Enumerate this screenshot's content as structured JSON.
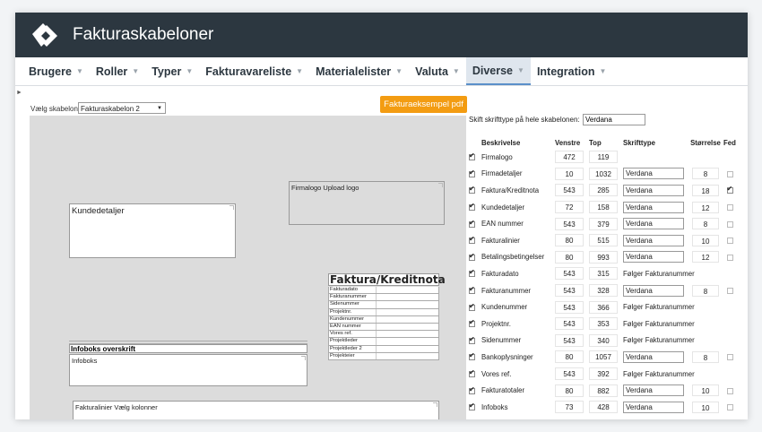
{
  "app": {
    "title": "Fakturaskabeloner"
  },
  "nav": [
    {
      "label": "Brugere"
    },
    {
      "label": "Roller"
    },
    {
      "label": "Typer"
    },
    {
      "label": "Fakturavareliste"
    },
    {
      "label": "Materialelister"
    },
    {
      "label": "Valuta"
    },
    {
      "label": "Diverse",
      "active": true
    },
    {
      "label": "Integration"
    }
  ],
  "editor": {
    "select_label": "Vælg skabelon",
    "template_value": "Fakturaskabelon 2",
    "pdf_button": "Fakturaeksempel pdf",
    "font_label": "Skift skrifttype på hele skabelonen:",
    "font_value": "Verdana"
  },
  "canvas": {
    "firmalogo": "Firmalogo Upload logo",
    "kundedetaljer": "Kundedetaljer",
    "faktura_title": "Faktura/Kreditnota",
    "faktura_fields": [
      "Fakturadato",
      "Fakturanummer",
      "Sidenummer",
      "Projektnr.",
      "Kundenummer",
      "EAN nummer",
      "Vores ref.",
      "Projektleder",
      "Projektleder 2",
      "Projekteier"
    ],
    "infoboks_title": "Infoboks overskrift",
    "infoboks": "Infoboks",
    "fakturalinier": "Fakturalinier Vælg kolonner"
  },
  "table": {
    "headers": {
      "desc": "Beskrivelse",
      "left": "Venstre",
      "top": "Top",
      "font": "Skrifttype",
      "size": "Størrelse",
      "bold": "Fed"
    },
    "follow_text": "Følger Fakturanummer",
    "rows": [
      {
        "desc": "Firmalogo",
        "left": "472",
        "top": "119",
        "font": "",
        "size": "",
        "bold": null
      },
      {
        "desc": "Firmadetaljer",
        "left": "10",
        "top": "1032",
        "font": "Verdana",
        "size": "8",
        "bold": false
      },
      {
        "desc": "Faktura/Kreditnota",
        "left": "543",
        "top": "285",
        "font": "Verdana",
        "size": "18",
        "bold": true
      },
      {
        "desc": "Kundedetaljer",
        "left": "72",
        "top": "158",
        "font": "Verdana",
        "size": "12",
        "bold": false
      },
      {
        "desc": "EAN nummer",
        "left": "543",
        "top": "379",
        "font": "Verdana",
        "size": "8",
        "bold": false
      },
      {
        "desc": "Fakturalinier",
        "left": "80",
        "top": "515",
        "font": "Verdana",
        "size": "10",
        "bold": false
      },
      {
        "desc": "Betalingsbetingelser",
        "left": "80",
        "top": "993",
        "font": "Verdana",
        "size": "12",
        "bold": false
      },
      {
        "desc": "Fakturadato",
        "left": "543",
        "top": "315",
        "follow": true
      },
      {
        "desc": "Fakturanummer",
        "left": "543",
        "top": "328",
        "font": "Verdana",
        "size": "8",
        "bold": false
      },
      {
        "desc": "Kundenummer",
        "left": "543",
        "top": "366",
        "follow": true
      },
      {
        "desc": "Projektnr.",
        "left": "543",
        "top": "353",
        "follow": true
      },
      {
        "desc": "Sidenummer",
        "left": "543",
        "top": "340",
        "follow": true
      },
      {
        "desc": "Bankoplysninger",
        "left": "80",
        "top": "1057",
        "font": "Verdana",
        "size": "8",
        "bold": false
      },
      {
        "desc": "Vores ref.",
        "left": "543",
        "top": "392",
        "follow": true
      },
      {
        "desc": "Fakturatotaler",
        "left": "80",
        "top": "882",
        "font": "Verdana",
        "size": "10",
        "bold": false
      },
      {
        "desc": "Infoboks",
        "left": "73",
        "top": "428",
        "font": "Verdana",
        "size": "10",
        "bold": false
      }
    ]
  },
  "colors": {
    "header": "#2c3740",
    "accent": "#f39c12",
    "active_tab": "#dfe6ee"
  }
}
